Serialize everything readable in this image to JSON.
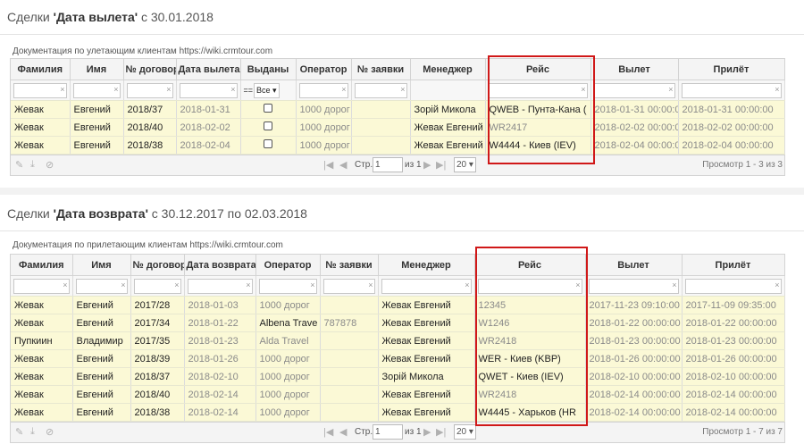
{
  "section1": {
    "title_prefix": "Сделки ",
    "title_bold": "'Дата вылета'",
    "title_suffix": " с 30.01.2018",
    "caption": "Документация по улетающим клиентам https://wiki.crmtour.com",
    "columns": [
      "Фамилия",
      "Имя",
      "№ договор",
      "Дата вылета",
      "Выданы",
      "Оператор",
      "№ заявки",
      "Менеджер",
      "Рейс",
      "Вылет",
      "Прилёт"
    ],
    "filter_eq": "==",
    "filter_select": "Все",
    "rows": [
      [
        "Жевак",
        "Евгений",
        "2018/37",
        "2018-01-31",
        "",
        "1000 дорог",
        "",
        "Зорій Микола",
        "QWEB - Пунта-Кана (",
        "2018-01-31 00:00:00",
        "2018-01-31 00:00:00"
      ],
      [
        "Жевак",
        "Евгений",
        "2018/40",
        "2018-02-02",
        "",
        "1000 дорог",
        "",
        "Жевак Евгений",
        "WR2417",
        "2018-02-02 00:00:00",
        "2018-02-02 00:00:00"
      ],
      [
        "Жевак",
        "Евгений",
        "2018/38",
        "2018-02-04",
        "",
        "1000 дорог",
        "",
        "Жевак Евгений",
        "W4444 - Киев (IEV)",
        "2018-02-04 00:00:00",
        "2018-02-04 00:00:00"
      ]
    ],
    "pager": {
      "page_label": "Стр.",
      "page": "1",
      "of_label": "из 1",
      "per_page": "20",
      "view_text": "Просмотр 1 - 3 из 3"
    }
  },
  "section2": {
    "title_prefix": "Сделки ",
    "title_bold": "'Дата возврата'",
    "title_suffix": " с 30.12.2017 по 02.03.2018",
    "caption": "Документация по прилетающим клиентам https://wiki.crmtour.com",
    "columns": [
      "Фамилия",
      "Имя",
      "№ договор",
      "Дата возврата",
      "Оператор",
      "№ заявки",
      "Менеджер",
      "Рейс",
      "Вылет",
      "Прилёт"
    ],
    "rows": [
      [
        "Жевак",
        "Евгений",
        "2017/28",
        "2018-01-03",
        "1000 дорог",
        "",
        "Жевак Евгений",
        "12345",
        "2017-11-23 09:10:00",
        "2017-11-09 09:35:00"
      ],
      [
        "Жевак",
        "Евгений",
        "2017/34",
        "2018-01-22",
        "Albena Trave",
        "787878",
        "Жевак Евгений",
        "W1246",
        "2018-01-22 00:00:00",
        "2018-01-22 00:00:00"
      ],
      [
        "Пупкиин",
        "Владимир",
        "2017/35",
        "2018-01-23",
        "Alda Travel",
        "",
        "Жевак Евгений",
        "WR2418",
        "2018-01-23 00:00:00",
        "2018-01-23 00:00:00"
      ],
      [
        "Жевак",
        "Евгений",
        "2018/39",
        "2018-01-26",
        "1000 дорог",
        "",
        "Жевак Евгений",
        "WER - Киев (KBP)",
        "2018-01-26 00:00:00",
        "2018-01-26 00:00:00"
      ],
      [
        "Жевак",
        "Евгений",
        "2018/37",
        "2018-02-10",
        "1000 дорог",
        "",
        "Зорій Микола",
        "QWET - Киев (IEV)",
        "2018-02-10 00:00:00",
        "2018-02-10 00:00:00"
      ],
      [
        "Жевак",
        "Евгений",
        "2018/40",
        "2018-02-14",
        "1000 дорог",
        "",
        "Жевак Евгений",
        "WR2418",
        "2018-02-14 00:00:00",
        "2018-02-14 00:00:00"
      ],
      [
        "Жевак",
        "Евгений",
        "2018/38",
        "2018-02-14",
        "1000 дорог",
        "",
        "Жевак Евгений",
        "W4445 - Харьков (HR",
        "2018-02-14 00:00:00",
        "2018-02-14 00:00:00"
      ]
    ],
    "pager": {
      "page_label": "Стр.",
      "page": "1",
      "of_label": "из 1",
      "per_page": "20",
      "view_text": "Просмотр 1 - 7 из 7"
    }
  },
  "icons": {
    "clear_filter": "×",
    "select_arrow": "▾",
    "first": "|◀",
    "prev": "◀",
    "next": "▶",
    "last": "▶|",
    "edit": "✎",
    "download": "⤓",
    "block": "⊘"
  },
  "colors": {
    "highlight_border": "#d01818",
    "row_bg": "#fbf9d6"
  }
}
